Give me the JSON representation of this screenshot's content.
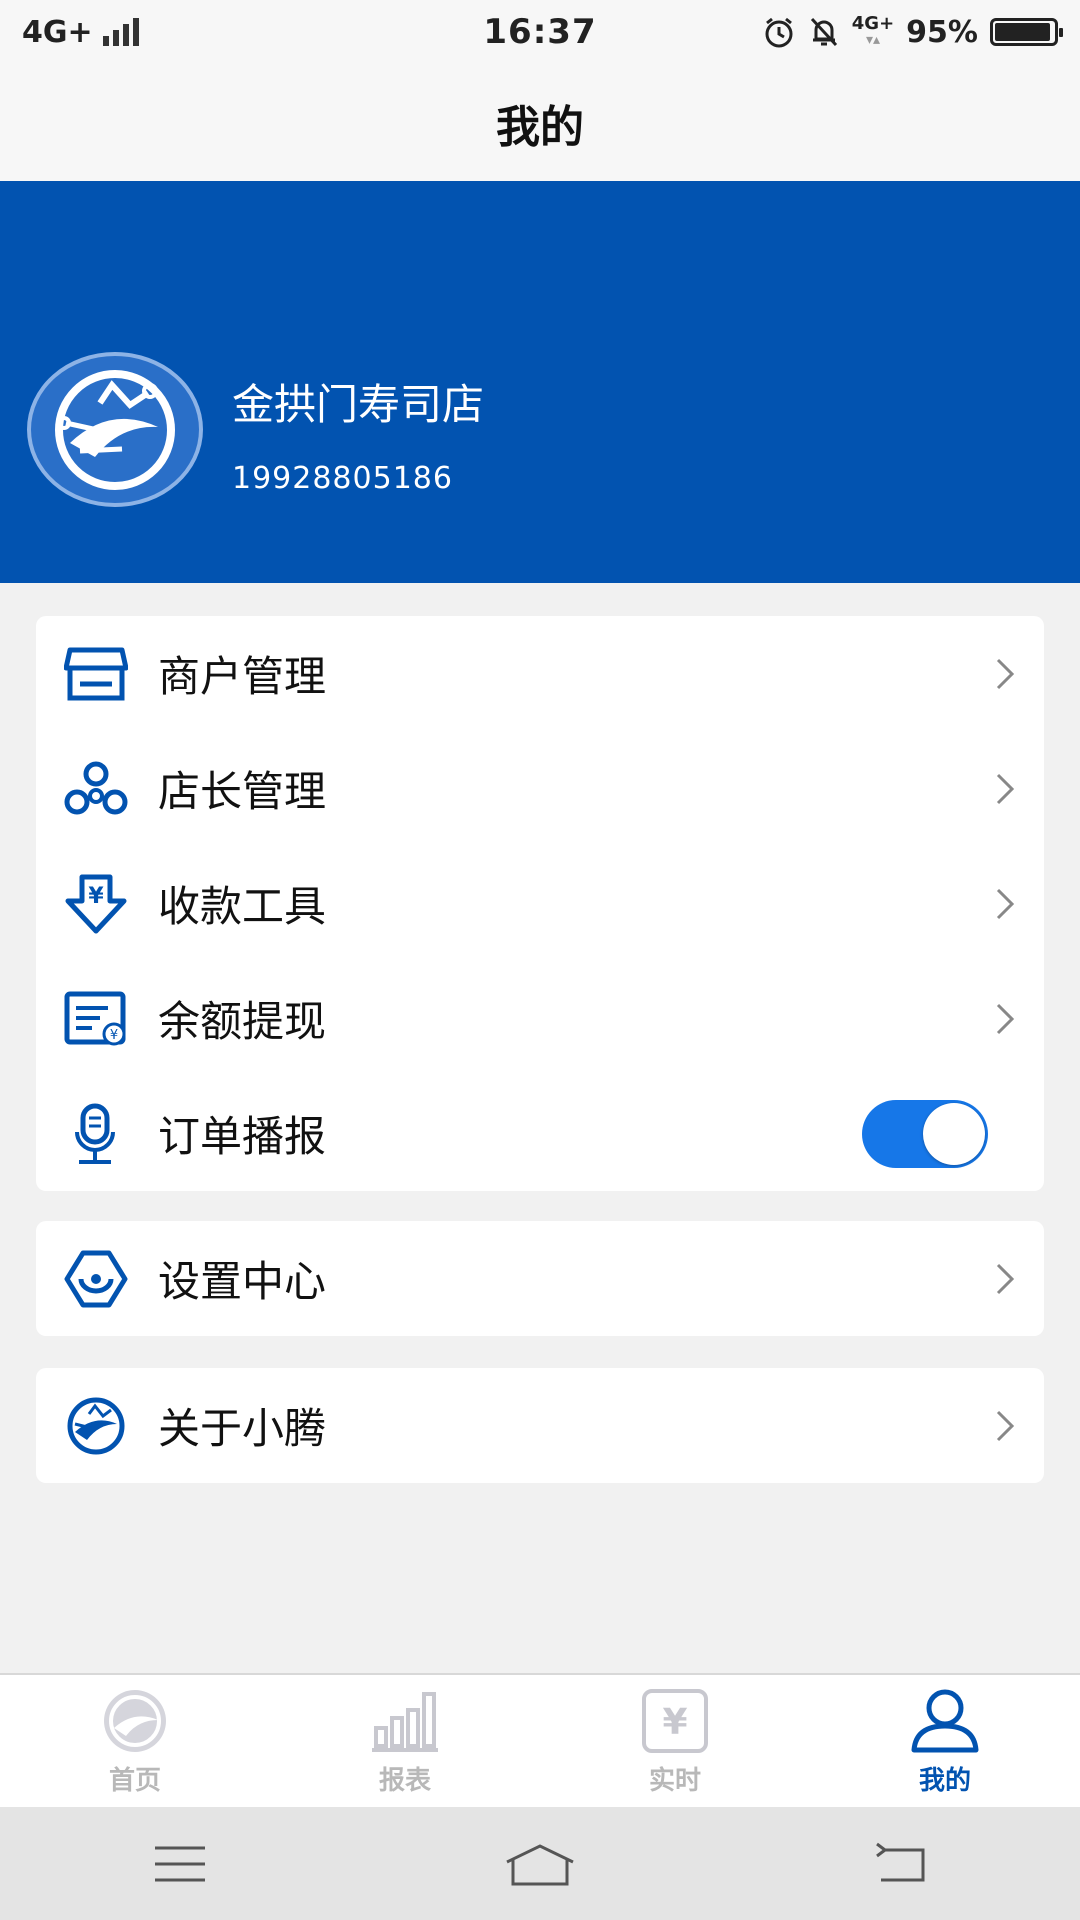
{
  "status_bar": {
    "network": "4G+",
    "time": "16:37",
    "network2": "4G+",
    "battery": "95%",
    "battery_level": 0.95
  },
  "title": "我的",
  "profile": {
    "store_name": "金拱门寿司店",
    "phone": "19928805186"
  },
  "menu": {
    "items": [
      {
        "label": "商户管理",
        "icon": "store-icon"
      },
      {
        "label": "店长管理",
        "icon": "team-icon"
      },
      {
        "label": "收款工具",
        "icon": "payment-tool-icon"
      },
      {
        "label": "余额提现",
        "icon": "withdraw-icon"
      },
      {
        "label": "订单播报",
        "icon": "microphone-icon",
        "toggle": true
      }
    ]
  },
  "settings": {
    "label": "设置中心",
    "icon": "settings-icon"
  },
  "about": {
    "label": "关于小腾",
    "icon": "about-logo-icon"
  },
  "tabs": [
    {
      "label": "首页",
      "icon": "home-logo-icon",
      "active": false
    },
    {
      "label": "报表",
      "icon": "report-chart-icon",
      "active": false
    },
    {
      "label": "实时",
      "icon": "realtime-yen-icon",
      "active": false
    },
    {
      "label": "我的",
      "icon": "user-icon",
      "active": true
    }
  ],
  "colors": {
    "primary": "#0253b0",
    "toggle_on": "#1677e8",
    "tab_inactive": "#b8b8b8",
    "background": "#f1f1f1"
  }
}
